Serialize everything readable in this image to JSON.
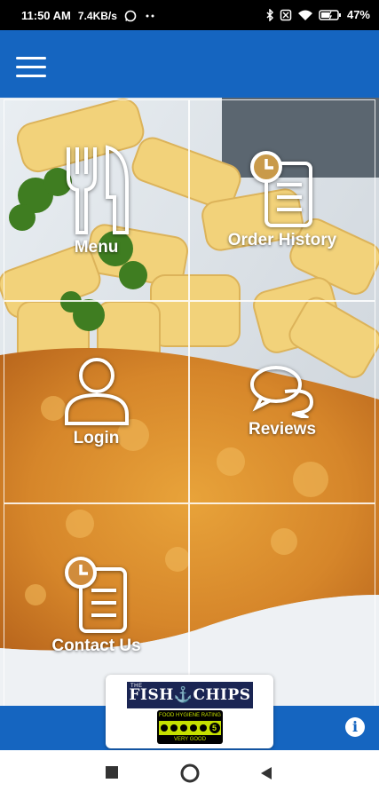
{
  "status_bar": {
    "time": "11:50 AM",
    "net_speed": "7.4KB/s",
    "battery": "47%",
    "icons": [
      "whatsapp-icon",
      "dots-icon",
      "bluetooth-icon",
      "sim-off-icon",
      "wifi-icon",
      "battery-icon"
    ]
  },
  "app_bar": {
    "menu_icon": "hamburger-icon",
    "color": "#1565c0"
  },
  "tiles": [
    {
      "label": "Menu",
      "icon": "fork-knife-icon"
    },
    {
      "label": "Order History",
      "icon": "clock-document-icon"
    },
    {
      "label": "Login",
      "icon": "user-icon"
    },
    {
      "label": "Reviews",
      "icon": "chat-bubbles-icon"
    },
    {
      "label": "Contact Us",
      "icon": "clock-document-icon"
    },
    {
      "label": "",
      "icon": ""
    }
  ],
  "badge": {
    "logo_small": "THE",
    "logo_text": "FISH⚓CHIPS",
    "hygiene_top": "FOOD HYGIENE RATING",
    "hygiene_score": "5",
    "hygiene_bottom": "VERY GOOD"
  },
  "bottom_bar": {
    "info_icon": "info-icon"
  },
  "nav": {
    "recent": "square-icon",
    "home": "circle-icon",
    "back": "triangle-back-icon"
  }
}
